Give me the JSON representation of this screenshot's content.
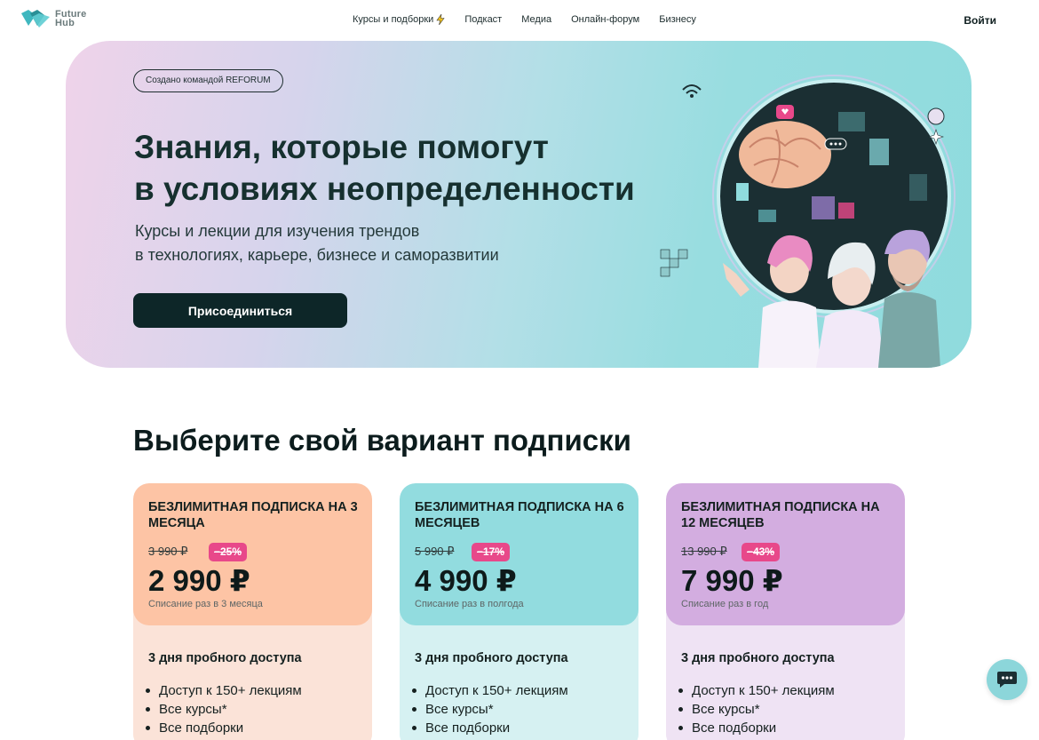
{
  "header": {
    "logo_text_line1": "Future",
    "logo_text_line2": "Hub",
    "nav": [
      {
        "label": "Курсы и подборки",
        "icon": "lightning-icon"
      },
      {
        "label": "Подкаст"
      },
      {
        "label": "Медиа"
      },
      {
        "label": "Онлайн-форум"
      },
      {
        "label": "Бизнесу"
      }
    ],
    "login_label": "Войти"
  },
  "hero": {
    "badge": "Создано командой REFORUM",
    "title_line1": "Знания, которые помогут",
    "title_line2": "в условиях неопределенности",
    "subtitle_line1": "Курсы и лекции для изучения трендов",
    "subtitle_line2": "в технологиях, карьере, бизнесе и саморазвитии",
    "cta_label": "Присоединиться"
  },
  "plans_section": {
    "title": "Выберите свой вариант подписки",
    "plans": [
      {
        "name": "Безлимитная подписка на 3 месяца",
        "old_price": "3 990 ₽",
        "discount": "−25%",
        "price": "2 990 ₽",
        "billing": "Списание раз в 3 месяца",
        "trial": "3 дня пробного доступа",
        "features": [
          "Доступ к 150+ лекциям",
          "Все курсы*",
          "Все подборки"
        ],
        "top_color": "#fdc4a5",
        "body_color": "#fbe3d8"
      },
      {
        "name": "Безлимитная подписка на 6 месяцев",
        "old_price": "5 990 ₽",
        "discount": "−17%",
        "price": "4 990 ₽",
        "billing": "Списание раз в полгода",
        "trial": "3 дня пробного доступа",
        "features": [
          "Доступ к 150+ лекциям",
          "Все курсы*",
          "Все подборки"
        ],
        "top_color": "#92dcdf",
        "body_color": "#d6f1f2"
      },
      {
        "name": "Безлимитная подписка на 12 месяцев",
        "old_price": "13 990 ₽",
        "discount": "−43%",
        "price": "7 990 ₽",
        "billing": "Списание раз в год",
        "trial": "3 дня пробного доступа",
        "features": [
          "Доступ к 150+ лекциям",
          "Все курсы*",
          "Все подборки"
        ],
        "top_color": "#d3ade0",
        "body_color": "#efe3f4"
      }
    ]
  },
  "chat": {
    "icon": "chat-bubble-icon"
  },
  "colors": {
    "accent_dark": "#0d2628",
    "discount_pink": "#e8488a"
  }
}
